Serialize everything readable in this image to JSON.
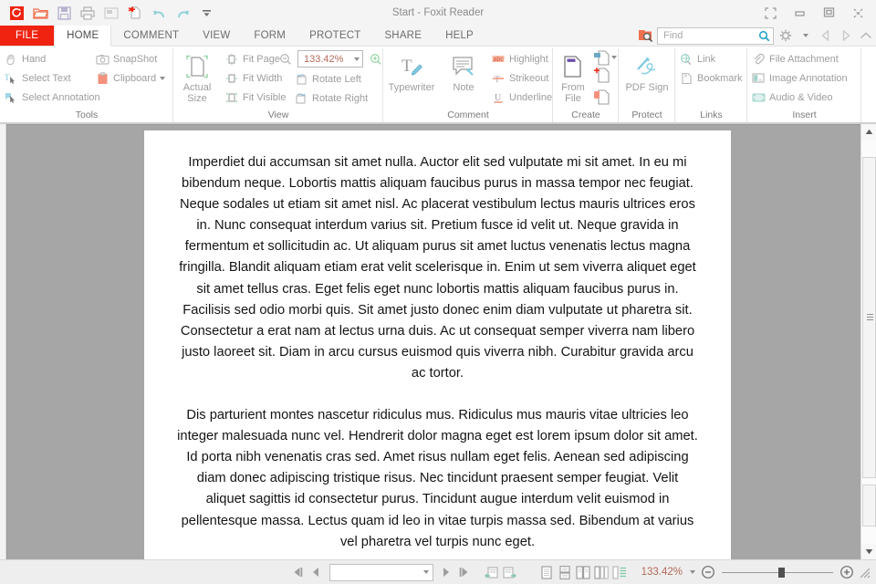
{
  "window": {
    "title": "Start - Foxit Reader",
    "controls": {
      "restore_down": "restore-down",
      "minimize": "minimize",
      "maximize": "maximize",
      "close": "close"
    }
  },
  "quick_access": [
    {
      "name": "foxit-logo-icon",
      "label": "Foxit Reader"
    },
    {
      "name": "open-icon",
      "label": "Open"
    },
    {
      "name": "save-icon",
      "label": "Save"
    },
    {
      "name": "print-icon",
      "label": "Print"
    },
    {
      "name": "email-icon",
      "label": "Email"
    },
    {
      "name": "create-pdf-icon",
      "label": "Create PDF"
    },
    {
      "name": "undo-icon",
      "label": "Undo"
    },
    {
      "name": "redo-icon",
      "label": "Redo"
    },
    {
      "name": "customize-toolbar-icon",
      "label": "Customize Toolbar"
    }
  ],
  "tabs": [
    {
      "label": "FILE",
      "state": "file"
    },
    {
      "label": "HOME",
      "state": "active"
    },
    {
      "label": "COMMENT",
      "state": "normal"
    },
    {
      "label": "VIEW",
      "state": "normal"
    },
    {
      "label": "FORM",
      "state": "normal"
    },
    {
      "label": "PROTECT",
      "state": "normal"
    },
    {
      "label": "SHARE",
      "state": "normal"
    },
    {
      "label": "HELP",
      "state": "normal"
    }
  ],
  "search": {
    "placeholder": "Find",
    "search_icon": "find-pdf-icon",
    "magnifier_icon": "magnifier-icon",
    "settings_icon": "gear-icon",
    "prev_icon": "previous-icon",
    "next_icon": "next-icon",
    "collapse_icon": "collapse-ribbon-icon"
  },
  "ribbon": {
    "groups": [
      {
        "label": "Tools",
        "columns": [
          [
            {
              "label": "Hand",
              "icon": "hand-icon"
            },
            {
              "label": "Select Text",
              "icon": "select-text-icon"
            },
            {
              "label": "Select Annotation",
              "icon": "select-annotation-icon"
            }
          ],
          [
            {
              "label": "SnapShot",
              "icon": "snapshot-icon"
            },
            {
              "label": "Clipboard",
              "icon": "clipboard-icon",
              "dropdown": true
            }
          ]
        ]
      },
      {
        "label": "View",
        "big": {
          "label": "Actual Size",
          "icon": "actual-size-icon"
        },
        "columns": [
          [
            {
              "label": "Fit Page",
              "icon": "fit-page-icon"
            },
            {
              "label": "Fit Width",
              "icon": "fit-width-icon"
            },
            {
              "label": "Fit Visible",
              "icon": "fit-visible-icon"
            }
          ],
          [
            {
              "label": "Rotate Left",
              "icon": "rotate-left-icon"
            },
            {
              "label": "Rotate Right",
              "icon": "rotate-right-icon"
            }
          ]
        ],
        "zoom_out_icon": "zoom-out-icon",
        "zoom_in_icon": "zoom-in-icon",
        "zoom_value": "133.42%"
      },
      {
        "label": "Comment",
        "big_items": [
          {
            "label": "Typewriter",
            "icon": "typewriter-icon"
          },
          {
            "label": "Note",
            "icon": "note-icon"
          }
        ],
        "columns": [
          [
            {
              "label": "Highlight",
              "icon": "highlight-icon"
            },
            {
              "label": "Strikeout",
              "icon": "strikeout-icon"
            },
            {
              "label": "Underline",
              "icon": "underline-icon"
            }
          ]
        ]
      },
      {
        "label": "Create",
        "big_items": [
          {
            "label": "From File",
            "icon": "from-file-icon"
          }
        ],
        "stack": [
          {
            "icon": "from-scanner-icon",
            "dropdown": true
          },
          {
            "icon": "blank-page-icon"
          },
          {
            "icon": "from-clipboard-icon"
          }
        ]
      },
      {
        "label": "Protect",
        "big_items": [
          {
            "label": "PDF Sign",
            "icon": "pdf-sign-icon",
            "dropdown": true
          }
        ]
      },
      {
        "label": "Links",
        "columns": [
          [
            {
              "label": "Link",
              "icon": "link-icon"
            },
            {
              "label": "Bookmark",
              "icon": "bookmark-icon"
            }
          ]
        ]
      },
      {
        "label": "Insert",
        "columns": [
          [
            {
              "label": "File Attachment",
              "icon": "file-attachment-icon"
            },
            {
              "label": "Image Annotation",
              "icon": "image-annotation-icon"
            },
            {
              "label": "Audio & Video",
              "icon": "audio-video-icon"
            }
          ]
        ]
      }
    ]
  },
  "document": {
    "paragraphs": [
      "Imperdiet dui accumsan sit amet nulla. Auctor elit sed vulputate mi sit amet. In eu mi bibendum neque. Lobortis mattis aliquam faucibus purus in massa tempor nec feugiat. Neque sodales ut etiam sit amet nisl. Ac placerat vestibulum lectus mauris ultrices eros in. Nunc consequat interdum varius sit. Pretium fusce id velit ut. Neque gravida in fermentum et sollicitudin ac. Ut aliquam purus sit amet luctus venenatis lectus magna fringilla. Blandit aliquam etiam erat velit scelerisque in. Enim ut sem viverra aliquet eget sit amet tellus cras. Eget felis eget nunc lobortis mattis aliquam faucibus purus in. Facilisis sed odio morbi quis. Sit amet justo donec enim diam vulputate ut pharetra sit. Consectetur a erat nam at lectus urna duis. Ac ut consequat semper viverra nam libero justo laoreet sit. Diam in arcu cursus euismod quis viverra nibh. Curabitur gravida arcu ac tortor.",
      "Dis parturient montes nascetur ridiculus mus. Ridiculus mus mauris vitae ultricies leo integer malesuada nunc vel. Hendrerit dolor magna eget est lorem ipsum dolor sit amet. Id porta nibh venenatis cras sed. Amet risus nullam eget felis. Aenean sed adipiscing diam donec adipiscing tristique risus. Nec tincidunt praesent semper feugiat. Velit aliquet sagittis id consectetur purus. Tincidunt augue interdum velit euismod in pellentesque massa. Lectus quam id leo in vitae turpis massa sed. Bibendum at varius vel pharetra vel turpis nunc eget."
    ]
  },
  "statusbar": {
    "first_page_icon": "first-page-icon",
    "prev_page_icon": "previous-page-icon",
    "page_value": "",
    "next_page_icon": "next-page-icon",
    "last_page_icon": "last-page-icon",
    "previous_view_icon": "previous-view-icon",
    "next_view_icon": "next-view-icon",
    "single_page_icon": "single-page-view-icon",
    "continuous_icon": "continuous-scrolling-icon",
    "facing_icon": "facing-pages-icon",
    "separate_cover_icon": "separate-cover-page-icon",
    "split_icon": "split-view-icon",
    "zoom_value": "133.42%",
    "zoom_out_icon": "zoom-out-icon",
    "zoom_in_icon": "zoom-in-icon",
    "resize_grip_icon": "resize-grip-icon"
  },
  "colors": {
    "brand_red": "#f02311",
    "accent_text": "#b56a5a",
    "viewer_bg": "#a6a6a6",
    "chrome": "#f4f4f4"
  }
}
